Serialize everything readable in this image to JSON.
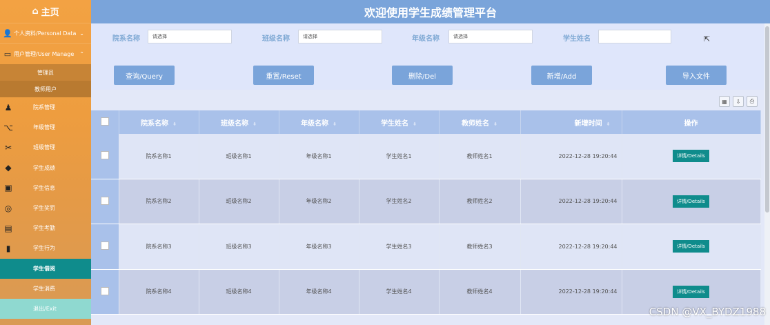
{
  "sidebar": {
    "home": "主页",
    "personal": "个人资料/Personal Data",
    "user_manage": "用户管理/User Manage",
    "sub_items": [
      "管理员",
      "教师用户"
    ],
    "items": [
      "院系管理",
      "年级管理",
      "班级管理",
      "学生成绩",
      "学生信息",
      "学生奖罚",
      "学生考勤",
      "学生行为",
      "学生借阅",
      "学生消费",
      "退出/Exit"
    ],
    "active_index": 8
  },
  "header": {
    "title": "欢迎使用学生成绩管理平台"
  },
  "search": {
    "fields": [
      {
        "label": "院系名称",
        "placeholder": "请选择"
      },
      {
        "label": "班级名称",
        "placeholder": "请选择"
      },
      {
        "label": "年级名称",
        "placeholder": "请选择"
      },
      {
        "label": "学生姓名",
        "placeholder": ""
      }
    ],
    "buttons": [
      "查询/Query",
      "重置/Reset",
      "删除/Del",
      "新增/Add",
      "导入文件"
    ]
  },
  "table": {
    "columns": [
      "院系名称",
      "班级名称",
      "年级名称",
      "学生姓名",
      "教师姓名",
      "新增时间",
      "操作"
    ],
    "rows": [
      [
        "院系名称1",
        "班级名称1",
        "年级名称1",
        "学生姓名1",
        "教师姓名1",
        "2022-12-28 19:20:44",
        "详情/Details"
      ],
      [
        "院系名称2",
        "班级名称2",
        "年级名称2",
        "学生姓名2",
        "教师姓名2",
        "2022-12-28 19:20:44",
        "详情/Details"
      ],
      [
        "院系名称3",
        "班级名称3",
        "年级名称3",
        "学生姓名3",
        "教师姓名3",
        "2022-12-28 19:20:44",
        "详情/Details"
      ],
      [
        "院系名称4",
        "班级名称4",
        "年级名称4",
        "学生姓名4",
        "教师姓名4",
        "2022-12-28 19:20:44",
        "详情/Details"
      ]
    ]
  },
  "watermark": "CSDN @VX_BYDZ1988",
  "colors": {
    "sidebar": "#ee9d3f",
    "header": "#7aa4da",
    "active": "#0f8c8c",
    "exit": "#8fd9d0"
  }
}
